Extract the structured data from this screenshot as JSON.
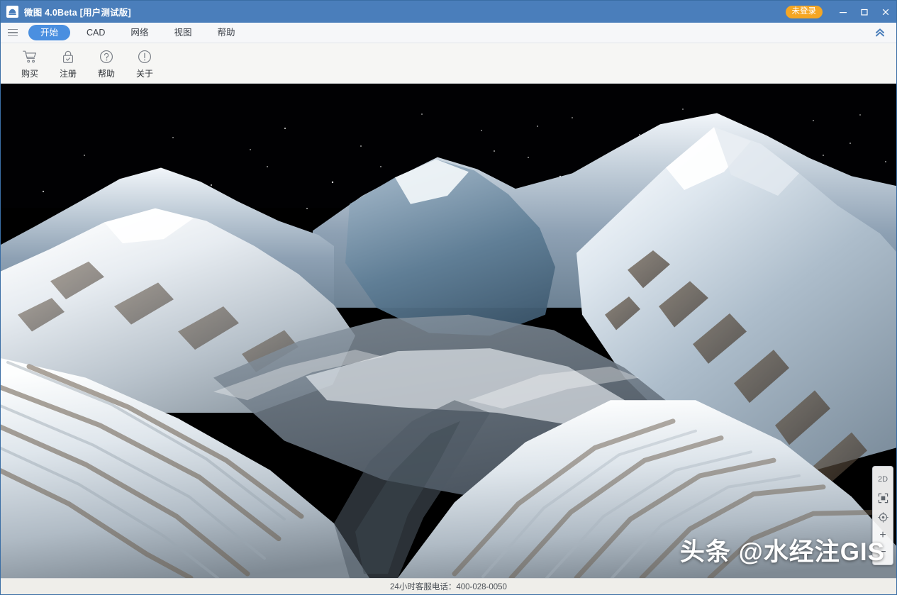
{
  "window": {
    "title": "微图 4.0Beta [用户测试版]",
    "app_icon": "mountain-logo-icon",
    "login_badge": "未登录",
    "minimize": "minimize-icon",
    "maximize": "maximize-icon",
    "close": "close-icon",
    "titlebar_color": "#4a7ebb",
    "badge_color": "#f5a623"
  },
  "menubar": {
    "menu_icon": "hamburger-icon",
    "collapse_icon": "chevron-double-up-icon",
    "active_tab": "开始",
    "accent_color": "#4a8fe0",
    "tabs": [
      {
        "label": "开始",
        "name": "tab-start",
        "active": true
      },
      {
        "label": "CAD",
        "name": "tab-cad",
        "active": false
      },
      {
        "label": "网络",
        "name": "tab-network",
        "active": false
      },
      {
        "label": "视图",
        "name": "tab-view",
        "active": false
      },
      {
        "label": "帮助",
        "name": "tab-help",
        "active": false
      }
    ]
  },
  "ribbon": {
    "items": [
      {
        "label": "购买",
        "icon": "shopping-cart-icon",
        "name": "ribbon-buy"
      },
      {
        "label": "注册",
        "icon": "lock-icon",
        "name": "ribbon-register"
      },
      {
        "label": "帮助",
        "icon": "question-circle-icon",
        "name": "ribbon-help"
      },
      {
        "label": "关于",
        "icon": "exclamation-circle-icon",
        "name": "ribbon-about"
      }
    ]
  },
  "viewport": {
    "scene": "3d-snow-mountain-terrain",
    "sky_color": "#010103",
    "watermark": "头条 @水经注GIS",
    "nav": {
      "mode_label": "2D",
      "buttons": [
        {
          "label": "2D",
          "icon": "mode-2d-toggle",
          "name": "nav-mode-2d"
        },
        {
          "label": "",
          "icon": "fit-extent-icon",
          "name": "nav-fit-extent"
        },
        {
          "label": "",
          "icon": "compass-icon",
          "name": "nav-compass"
        },
        {
          "label": "+",
          "icon": "zoom-in-icon",
          "name": "nav-zoom-in"
        },
        {
          "label": "−",
          "icon": "zoom-out-icon",
          "name": "nav-zoom-out"
        }
      ]
    }
  },
  "statusbar": {
    "text": "24小时客服电话：400-028-0050"
  }
}
